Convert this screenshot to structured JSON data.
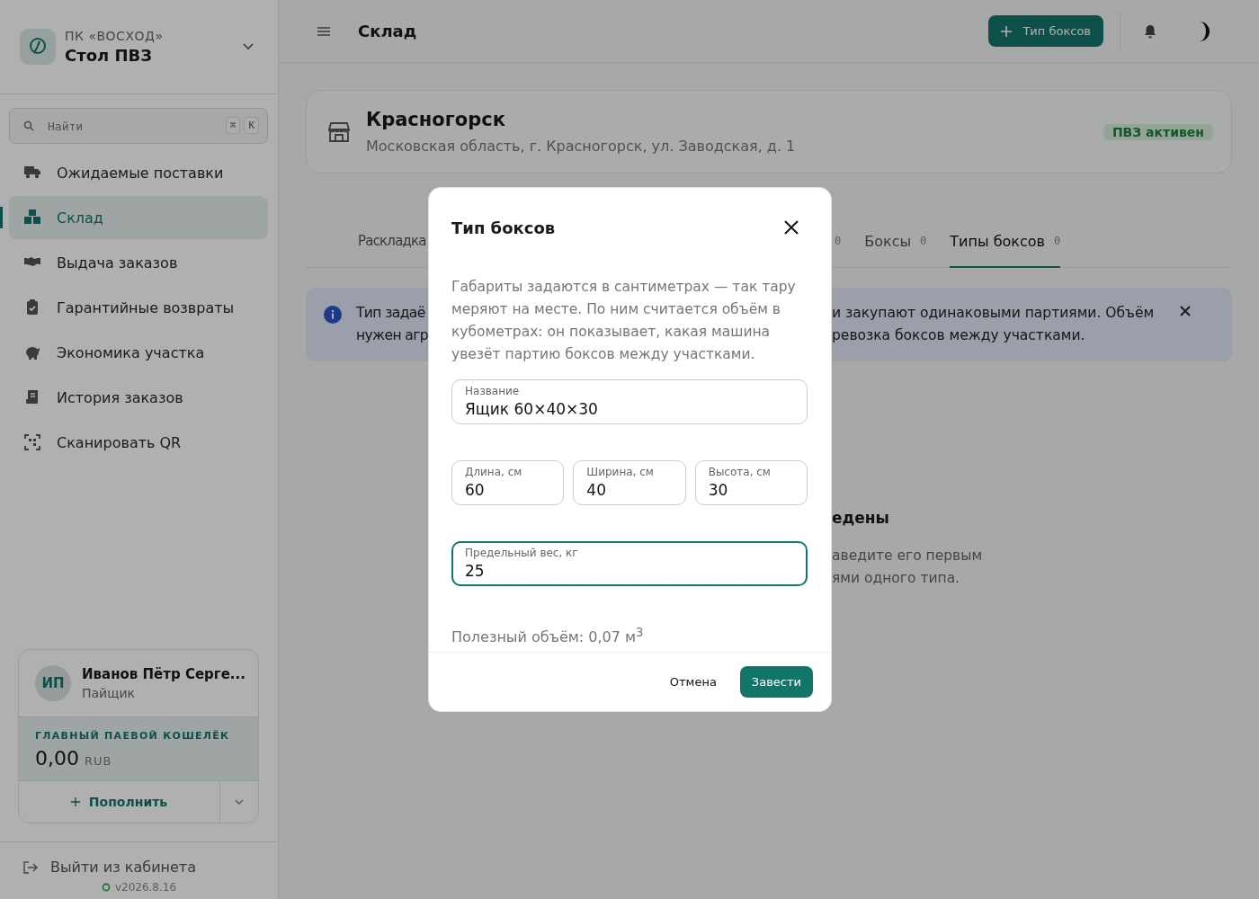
{
  "sidebar": {
    "org": "ПК «ВОСХОД»",
    "title": "Стол ПВЗ",
    "search": {
      "placeholder": "Найти",
      "keys": [
        "⌘",
        "К"
      ]
    },
    "nav": [
      {
        "label": "Ожидаемые поставки",
        "selected": false
      },
      {
        "label": "Склад",
        "selected": true
      },
      {
        "label": "Выдача заказов",
        "selected": false
      },
      {
        "label": "Гарантийные возвраты",
        "selected": false
      },
      {
        "label": "Экономика участка",
        "selected": false
      },
      {
        "label": "История заказов",
        "selected": false
      },
      {
        "label": "Сканировать QR",
        "selected": false
      }
    ],
    "user": {
      "initials": "ИП",
      "name": "Иванов Пётр Серге...",
      "role": "Пайщик"
    },
    "wallet": {
      "label": "ГЛАВНЫЙ ПАЕВОЙ КОШЕЛЁК",
      "amount": "0,00",
      "currency": "RUB",
      "action": "Пополнить"
    },
    "logout": "Выйти из кабинета",
    "version": "v2026.8.16"
  },
  "topbar": {
    "title": "Склад",
    "action": "Тип боксов"
  },
  "location": {
    "name": "Красногорск",
    "address": "Московская область, г. Красногорск, ул. Заводская, д. 1",
    "status": "ПВЗ активен"
  },
  "tabs": {
    "left": [
      {
        "label": "Раскладка",
        "selected": false
      }
    ],
    "right": [
      {
        "count": "0",
        "selected": false
      },
      {
        "label": "Боксы",
        "count": "0",
        "selected": false
      },
      {
        "label": "Типы боксов",
        "count": "0",
        "selected": true
      }
    ]
  },
  "info": {
    "left": [
      "Тип задаё",
      "нужен агр"
    ],
    "right": [
      "и закупают одинаковыми партиями. Объём",
      "ревозка боксов между участками."
    ]
  },
  "empty": {
    "title": "едены",
    "lines": [
      "аведите его первым",
      "ями одного типа."
    ]
  },
  "dialog": {
    "title": "Тип боксов",
    "description": "Габариты задаются в сантиметрах — так тару меряют на месте. По ним считается объём в кубометрах: он показывает, какая машина увезёт партию боксов между участками.",
    "fields": [
      [
        {
          "label": "Название",
          "value": "Ящик 60×40×30",
          "focused": false
        }
      ],
      [
        {
          "label": "Длина, см",
          "value": "60",
          "focused": false
        },
        {
          "label": "Ширина, см",
          "value": "40",
          "focused": false
        },
        {
          "label": "Высота, см",
          "value": "30",
          "focused": false
        }
      ],
      [
        {
          "label": "Предельный вес, кг",
          "value": "25",
          "focused": true
        }
      ]
    ],
    "volume": "Полезный объём: 0,07 м$^{3}$",
    "cancel": "Отмена",
    "submit": "Завести"
  }
}
